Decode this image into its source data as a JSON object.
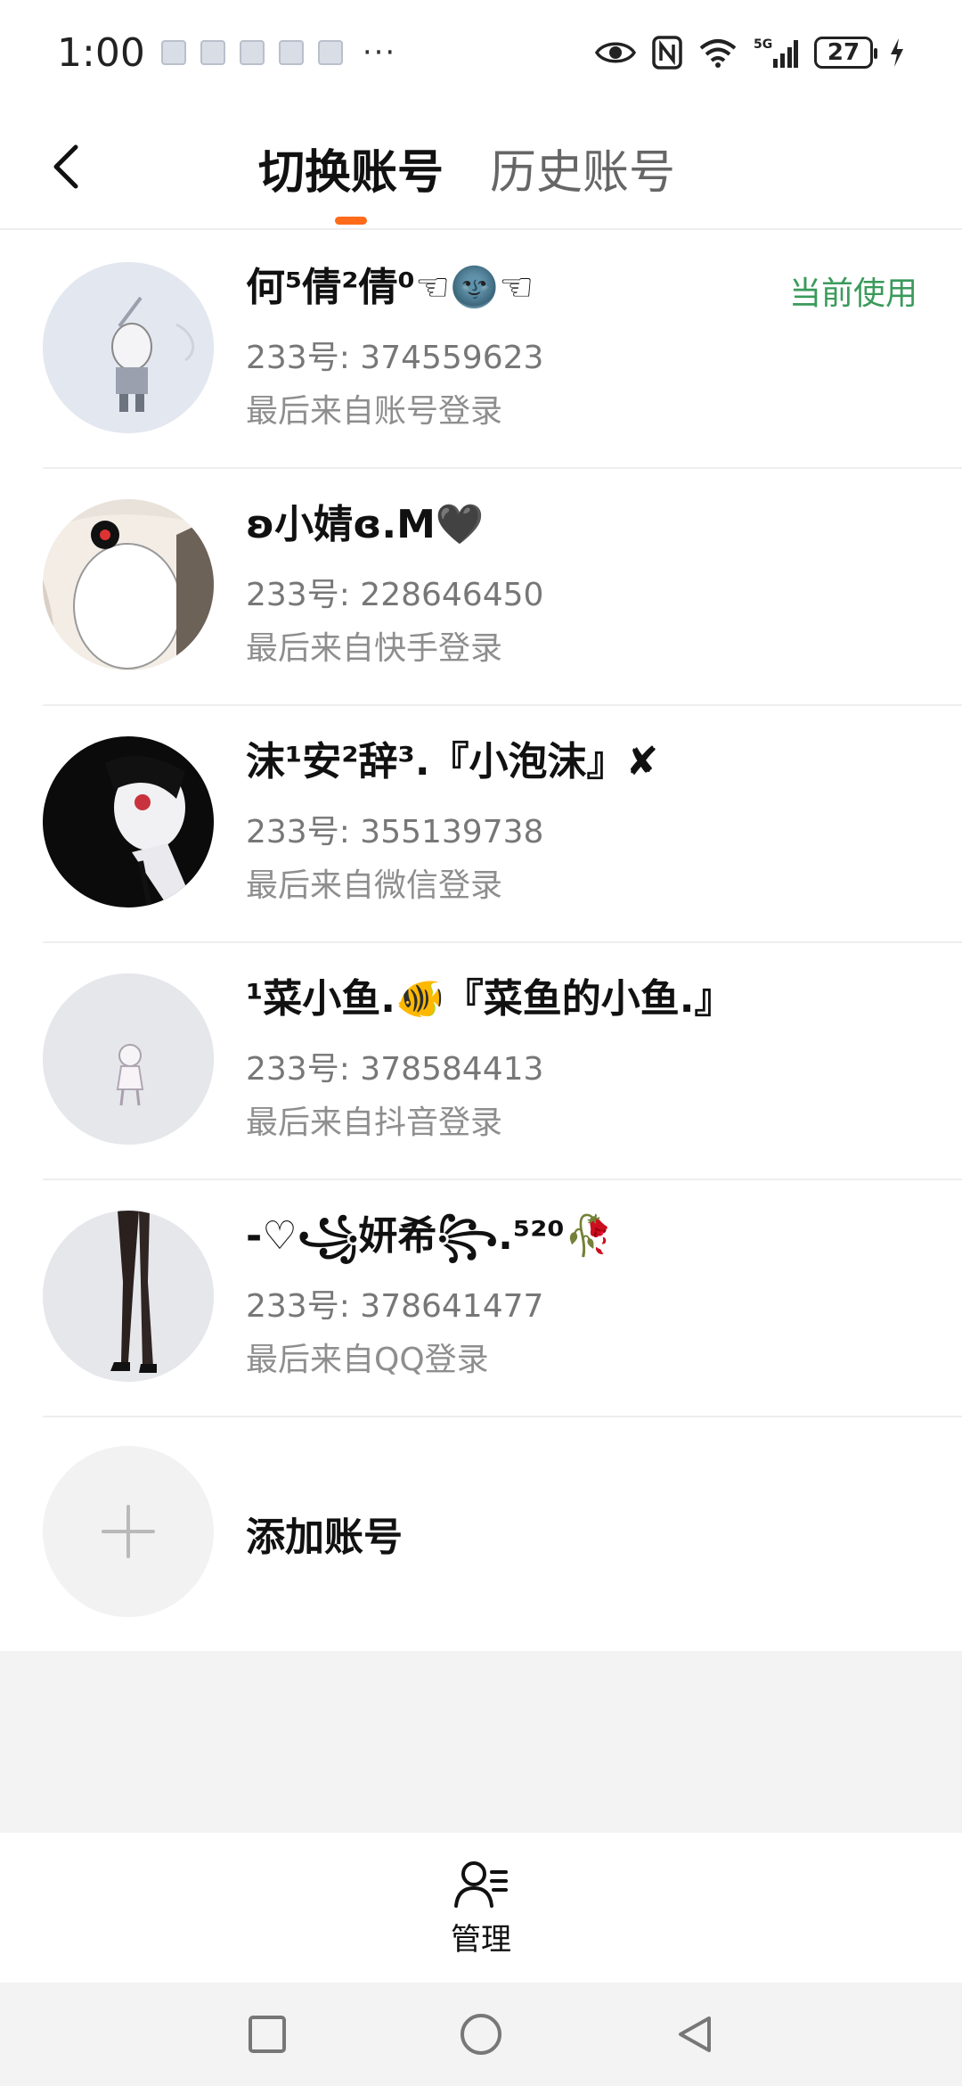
{
  "status_bar": {
    "time": "1:00",
    "more": "···",
    "network": "5G",
    "battery": "27"
  },
  "header": {
    "tabs": [
      {
        "label": "切换账号",
        "active": true
      },
      {
        "label": "历史账号",
        "active": false
      }
    ]
  },
  "accounts": [
    {
      "name": "何⁵倩²倩⁰☜🌚☜",
      "id": "233号: 374559623",
      "source": "最后来自账号登录",
      "badge": "当前使用"
    },
    {
      "name": "ʚ小婧ɞ.M🖤",
      "id": "233号: 228646450",
      "source": "最后来自快手登录"
    },
    {
      "name": "沫¹安²辞³.『小泡沫』✘",
      "id": "233号: 355139738",
      "source": "最后来自微信登录"
    },
    {
      "name": "¹菜小鱼.🐠『菜鱼的小鱼.』",
      "id": "233号: 378584413",
      "source": "最后来自抖音登录"
    },
    {
      "name": "-♡꧁妍希꧂.⁵²⁰🥀",
      "id": "233号: 378641477",
      "source": "最后来自QQ登录"
    }
  ],
  "add_account": {
    "label": "添加账号"
  },
  "bottom_bar": {
    "manage_label": "管理"
  },
  "colors": {
    "accent": "#ff6b1a",
    "current_badge": "#3a9a5b"
  }
}
